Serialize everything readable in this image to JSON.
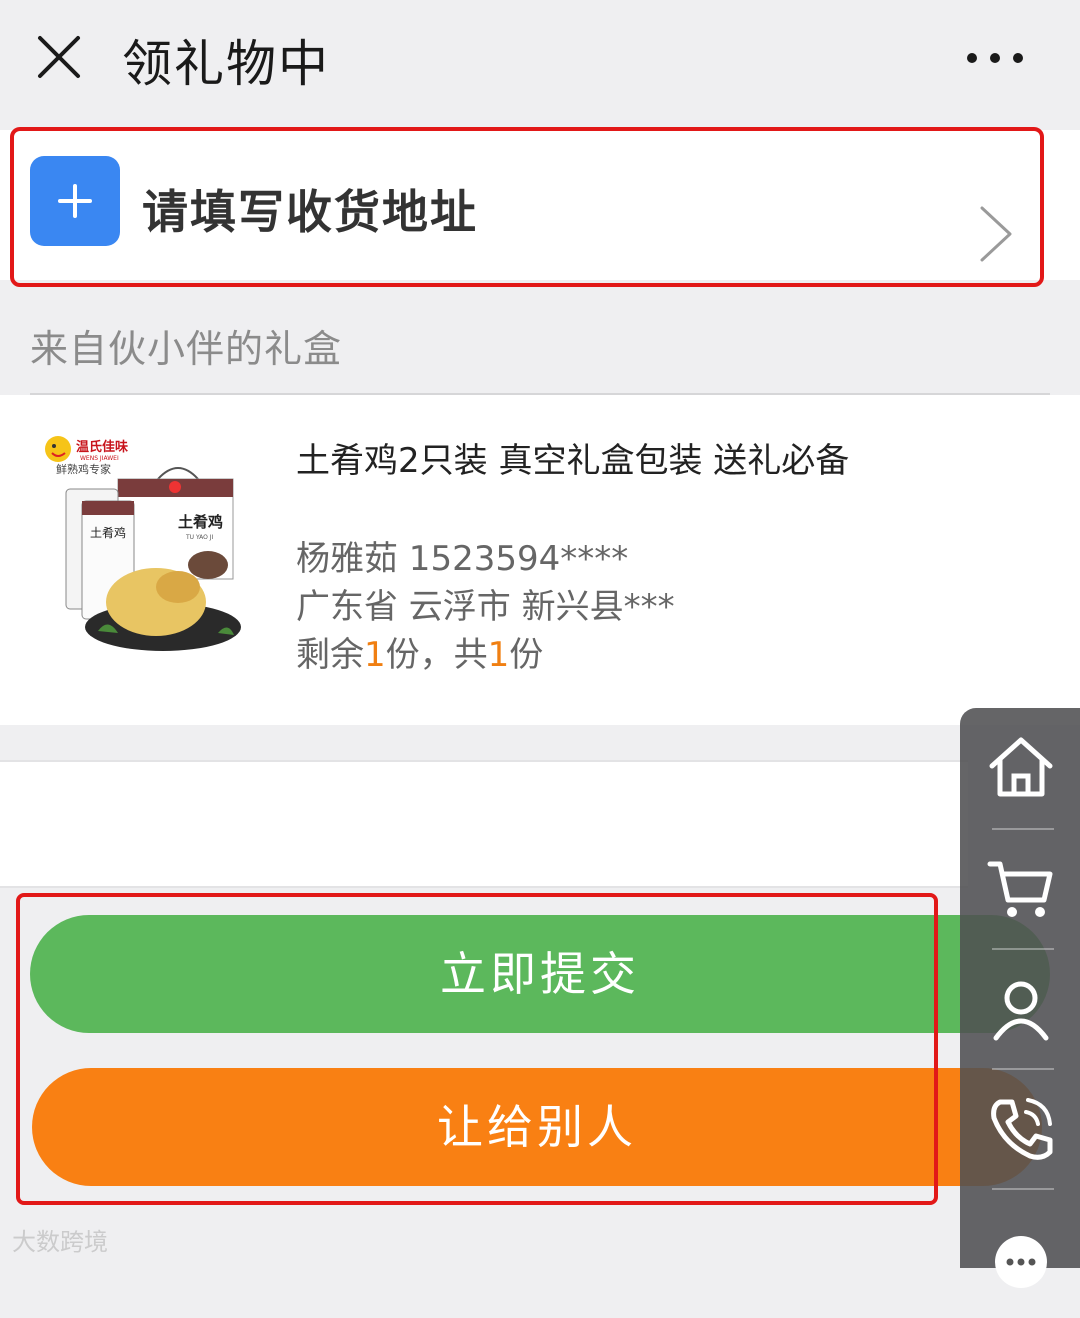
{
  "header": {
    "title": "领礼物中",
    "close_icon": "close-icon",
    "more_icon": "more-dots-icon"
  },
  "address": {
    "prompt": "请填写收货地址",
    "add_icon": "plus-icon",
    "chevron_icon": "chevron-right-icon"
  },
  "gift_box": {
    "label": "来自伙小伴的礼盒"
  },
  "product": {
    "name": "土肴鸡2只装 真空礼盒包装 送礼必备",
    "recipient": "杨雅茹 1523594****",
    "address": "广东省 云浮市 新兴县***",
    "quantity_prefix": "剩余",
    "remaining": "1",
    "quantity_mid": "份，共",
    "total": "1",
    "quantity_suffix": "份",
    "image_brand": "温氏佳味",
    "image_brand_en": "WENS JIAWEI",
    "image_slogan": "鲜熟鸡专家",
    "image_package_text": "土肴鸡",
    "image_package_en": "TU YAO JI"
  },
  "actions": {
    "submit_label": "立即提交",
    "give_label": "让给别人"
  },
  "side_toolbar": {
    "items": [
      "home-icon",
      "cart-icon",
      "user-icon",
      "phone-icon",
      "chat-icon"
    ]
  },
  "watermark": "大数跨境",
  "colors": {
    "accent_blue": "#3a87f2",
    "submit_green": "#5cb85c",
    "give_orange": "#f98013",
    "highlight_red": "#e21818",
    "number_orange": "#f07f12"
  }
}
